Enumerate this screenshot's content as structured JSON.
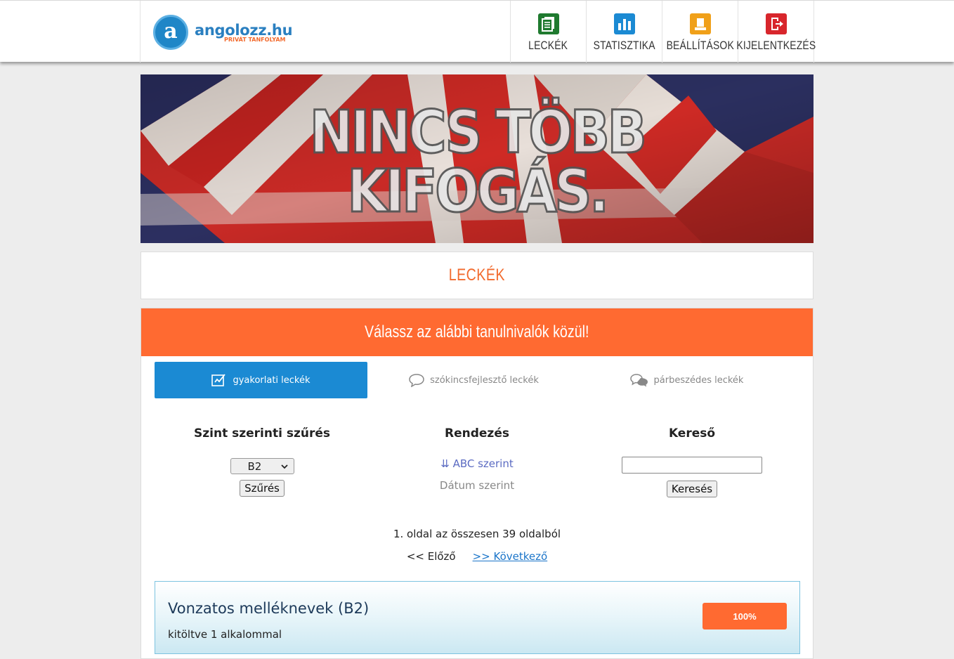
{
  "brand": {
    "logo_letter": "a",
    "name": "angolozz.hu",
    "tagline": "PRIVÁT TANFOLYAM"
  },
  "nav": [
    {
      "label": "LECKÉK",
      "icon": "lessons-icon",
      "color": "#1f7a2f"
    },
    {
      "label": "STATISZTIKA",
      "icon": "statistics-icon",
      "color": "#1b8ad3"
    },
    {
      "label": "BEÁLLÍTÁSOK",
      "icon": "settings-icon",
      "color": "#f0a019"
    },
    {
      "label": "KIJELENTKEZÉS",
      "icon": "logout-icon",
      "color": "#d8262c"
    }
  ],
  "banner": {
    "text": "NINCS TÖBB KIFOGÁS."
  },
  "section": {
    "title": "LECKÉK"
  },
  "panel": {
    "heading": "Válassz az alábbi tanulnivalók közül!",
    "tabs": [
      {
        "label": "gyakorlati leckék",
        "icon": "edit-icon",
        "active": true
      },
      {
        "label": "szókincsfejlesztő leckék",
        "icon": "speech-bubble-icon",
        "active": false
      },
      {
        "label": "párbeszédes leckék",
        "icon": "chat-bubbles-icon",
        "active": false
      }
    ],
    "filter": {
      "title": "Szint szerinti szűrés",
      "selected": "B2",
      "button": "Szűrés"
    },
    "sort": {
      "title": "Rendezés",
      "abc": "⇊ ABC szerint",
      "date": "Dátum szerint"
    },
    "search": {
      "title": "Kereső",
      "value": "",
      "button": "Keresés"
    },
    "pager": {
      "info": "1. oldal az összesen 39 oldalból",
      "prev": "<< Előző",
      "next": ">> Következő"
    },
    "lessons": [
      {
        "title": "Vonzatos melléknevek (B2)",
        "subtitle": "kitöltve 1 alkalommal",
        "score": "100%"
      }
    ]
  },
  "colors": {
    "accent_orange": "#ff6a31",
    "accent_blue": "#1b8ad3"
  }
}
